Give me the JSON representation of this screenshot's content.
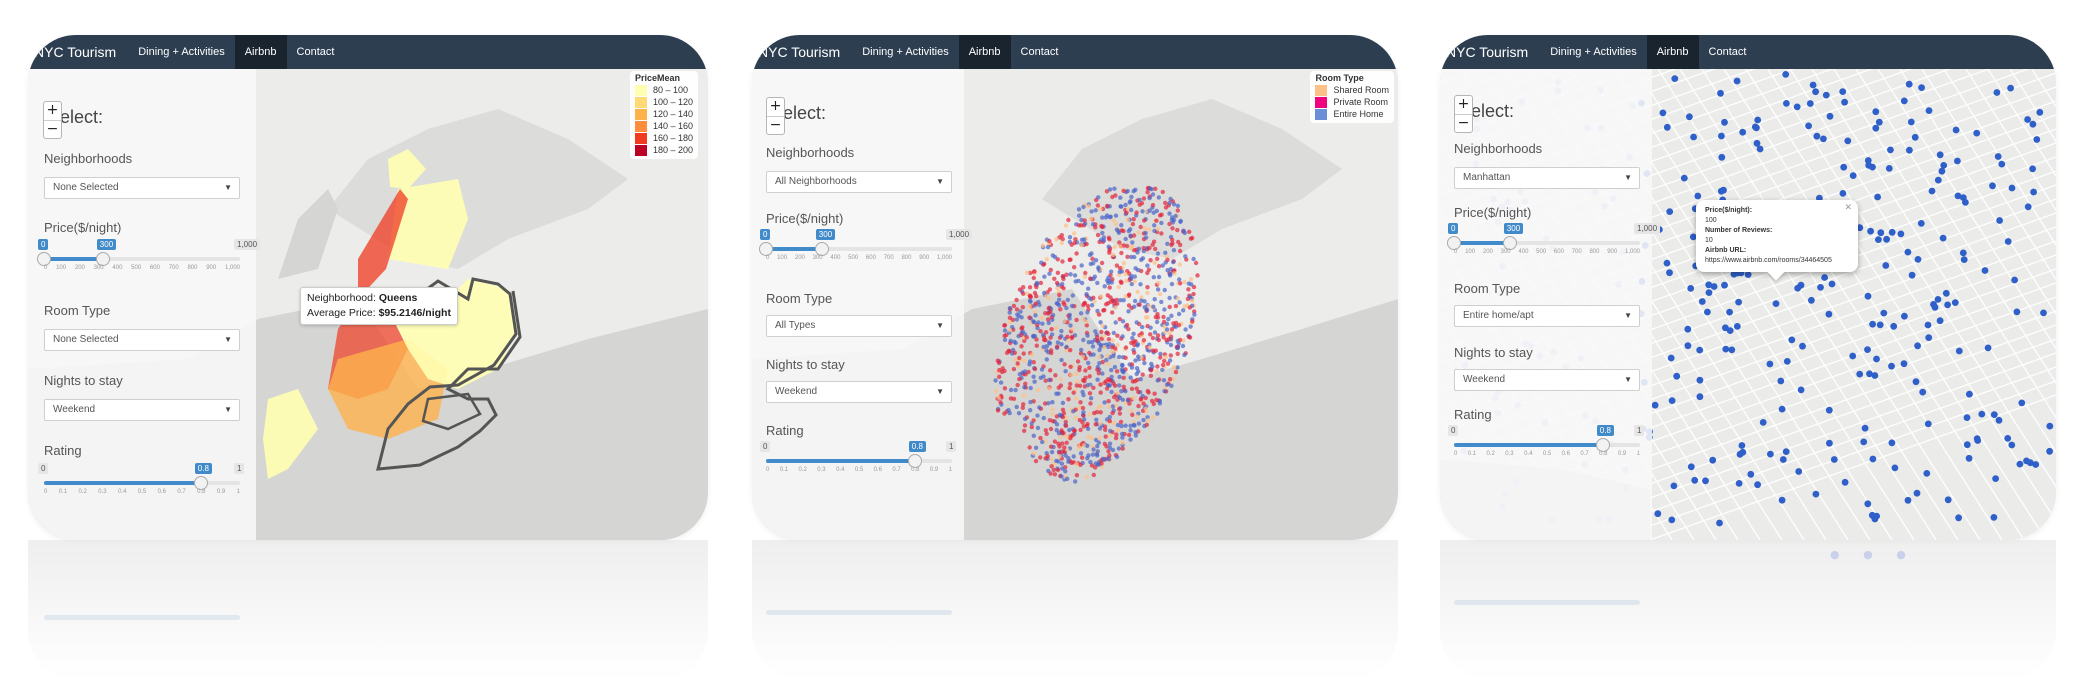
{
  "nav": {
    "brand": "NYC Tourism",
    "items": [
      "Dining + Activities",
      "Airbnb",
      "Contact"
    ],
    "active": "Airbnb"
  },
  "panel": {
    "title": "Select:",
    "neighborhoods_label": "Neighborhoods",
    "price_label": "Price($/night)",
    "room_type_label": "Room Type",
    "nights_label": "Nights to stay",
    "rating_label": "Rating"
  },
  "zoom": {
    "in": "+",
    "out": "−"
  },
  "price_slider": {
    "min": "0",
    "max": "1,000",
    "from": "0",
    "to": "300",
    "from_value": 0,
    "to_value": 300,
    "range": [
      0,
      1000
    ],
    "ticks": [
      "0",
      "100",
      "200",
      "300",
      "400",
      "500",
      "600",
      "700",
      "800",
      "900",
      "1,000"
    ]
  },
  "rating_slider": {
    "min": "0",
    "max": "1",
    "value": "0.8",
    "value_number": 0.8,
    "ticks": [
      "0",
      "0.1",
      "0.2",
      "0.3",
      "0.4",
      "0.5",
      "0.6",
      "0.7",
      "0.8",
      "0.9",
      "1"
    ]
  },
  "screens": [
    {
      "neighborhood": "None Selected",
      "room_type": "None Selected",
      "nights": "Weekend",
      "legend": {
        "title": "PriceMean",
        "entries": [
          {
            "label": "80 – 100",
            "color": "#ffffb2"
          },
          {
            "label": "100 – 120",
            "color": "#fed976"
          },
          {
            "label": "120 – 140",
            "color": "#feb24c"
          },
          {
            "label": "140 – 160",
            "color": "#fd8d3c"
          },
          {
            "label": "160 – 180",
            "color": "#f03b20"
          },
          {
            "label": "180 – 200",
            "color": "#bd0026"
          }
        ]
      },
      "tooltip": {
        "neighborhood_prefix": "Neighborhood: ",
        "neighborhood": "Queens",
        "price_prefix": "Average Price: ",
        "price": "$95.2146/night"
      }
    },
    {
      "neighborhood": "All Neighborhoods",
      "room_type": "All Types",
      "nights": "Weekend",
      "legend": {
        "title": "Room Type",
        "entries": [
          {
            "label": "Shared Room",
            "color": "#fdc086"
          },
          {
            "label": "Private Room",
            "color": "#f0027f"
          },
          {
            "label": "Entire Home",
            "color": "#6a8fd6"
          }
        ]
      }
    },
    {
      "neighborhood": "Manhattan",
      "room_type": "Entire home/apt",
      "nights": "Weekend",
      "popup": {
        "price_label": "Price($/night):",
        "price": "100",
        "reviews_label": "Number of Reviews:",
        "reviews": "10",
        "url_label": "Airbnb URL:",
        "url": "https://www.airbnb.com/rooms/34464505"
      }
    }
  ],
  "colors": {
    "navbar": "#2d3e50",
    "navbar_active": "#1a242f",
    "slider_fill": "#428bca",
    "water": "#d5d5d3",
    "land": "#ececea",
    "entire_home_dot": "#2f5fc9"
  }
}
